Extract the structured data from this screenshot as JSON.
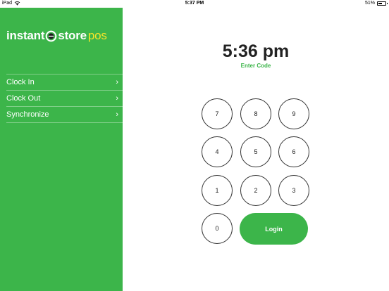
{
  "status_bar": {
    "device": "iPad",
    "time": "5:37 PM",
    "battery": "51%",
    "battery_level": 0.51
  },
  "sidebar": {
    "logo": {
      "part1": "instant",
      "part2": "store",
      "part3": "pos"
    },
    "items": [
      {
        "label": "Clock In",
        "chevron": "›"
      },
      {
        "label": "Clock Out",
        "chevron": "›"
      },
      {
        "label": "Synchronize",
        "chevron": "›"
      }
    ]
  },
  "main": {
    "time": "5:36 pm",
    "prompt": "Enter Code",
    "keypad": {
      "rows": [
        [
          "7",
          "8",
          "9"
        ],
        [
          "4",
          "5",
          "6"
        ],
        [
          "1",
          "2",
          "3"
        ]
      ],
      "zero": "0",
      "login_label": "Login"
    }
  },
  "colors": {
    "brand_green": "#3cb54a",
    "logo_accent": "#f2e32a"
  }
}
